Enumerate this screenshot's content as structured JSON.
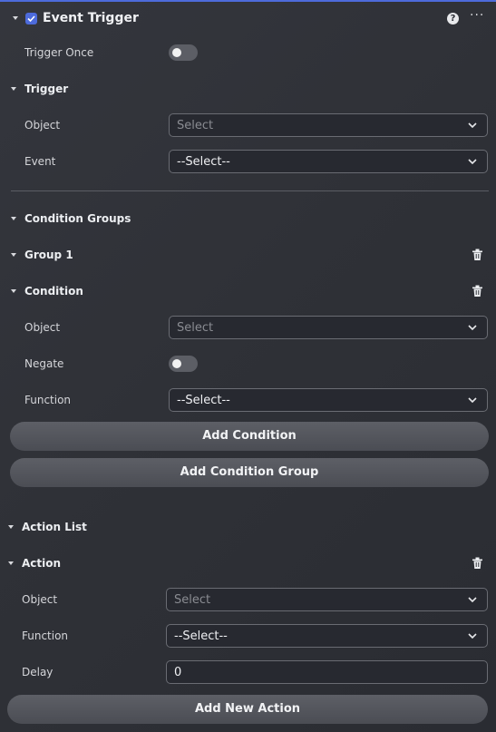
{
  "header": {
    "title": "Event Trigger",
    "help_icon": "?",
    "more_icon": "···"
  },
  "trigger_once": {
    "label": "Trigger Once",
    "checked": false
  },
  "trigger": {
    "label": "Trigger",
    "object": {
      "label": "Object",
      "placeholder": "Select"
    },
    "event": {
      "label": "Event",
      "value": "--Select--"
    }
  },
  "condition_groups": {
    "label": "Condition Groups",
    "group": {
      "label": "Group 1"
    },
    "condition": {
      "label": "Condition",
      "object": {
        "label": "Object",
        "placeholder": "Select"
      },
      "negate": {
        "label": "Negate",
        "checked": false
      },
      "function": {
        "label": "Function",
        "value": "--Select--"
      }
    },
    "add_condition_label": "Add Condition",
    "add_group_label": "Add Condition Group"
  },
  "action_list": {
    "label": "Action List",
    "action": {
      "label": "Action",
      "object": {
        "label": "Object",
        "placeholder": "Select"
      },
      "function": {
        "label": "Function",
        "value": "--Select--"
      },
      "delay": {
        "label": "Delay",
        "value": "0"
      }
    },
    "add_action_label": "Add New Action"
  },
  "colors": {
    "accent": "#4d6bdb",
    "background": "#2e3037",
    "button": "#55575e"
  }
}
